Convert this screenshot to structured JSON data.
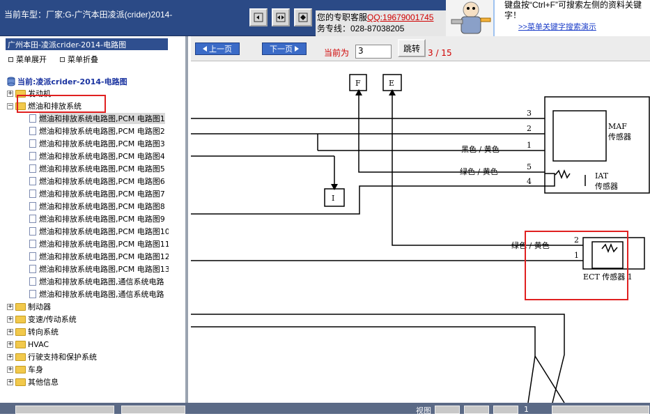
{
  "topbar": {
    "car_model": "当前车型：厂家:G-广汽本田凌派(crider)2014-",
    "support_line1_prefix": "您的专职客服",
    "support_qq": "QQ:19679001745",
    "support_line2": "务专线：028-87038205",
    "tip_line1": "键盘按“Ctrl+F”可搜索左侧的资料关键",
    "tip_line2": "字！",
    "tip_link": ">>菜单关键字搜索演示"
  },
  "left": {
    "title": "广州本田-凌派crider-2014-电路图",
    "expand_label": "菜单展开",
    "collapse_label": "菜单折叠",
    "current_label": "当前:凌派crider-2014-电路图",
    "tree": [
      {
        "label": "发动机",
        "expanded": false
      },
      {
        "label": "燃油和排放系统",
        "expanded": true
      },
      {
        "label": "制动器",
        "expanded": false
      },
      {
        "label": "变速/传动系统",
        "expanded": false
      },
      {
        "label": "转向系统",
        "expanded": false
      },
      {
        "label": "HVAC",
        "expanded": false
      },
      {
        "label": "行驶支持和保护系统",
        "expanded": false
      },
      {
        "label": "车身",
        "expanded": false
      },
      {
        "label": "其他信息",
        "expanded": false
      }
    ],
    "leaves": [
      "燃油和排放系统电路图,PCM 电路图1",
      "燃油和排放系统电路图,PCM 电路图2",
      "燃油和排放系统电路图,PCM 电路图3",
      "燃油和排放系统电路图,PCM 电路图4",
      "燃油和排放系统电路图,PCM 电路图5",
      "燃油和排放系统电路图,PCM 电路图6",
      "燃油和排放系统电路图,PCM 电路图7",
      "燃油和排放系统电路图,PCM 电路图8",
      "燃油和排放系统电路图,PCM 电路图9",
      "燃油和排放系统电路图,PCM 电路图10",
      "燃油和排放系统电路图,PCM 电路图11",
      "燃油和排放系统电路图,PCM 电路图12",
      "燃油和排放系统电路图,PCM 电路图13",
      "燃油和排放系统电路图,通信系统电路",
      "燃油和排放系统电路图,通信系统电路"
    ]
  },
  "nav": {
    "prev_label": "上一页",
    "next_label": "下一页",
    "current_prefix": "当前为",
    "page_value": "3",
    "jump_label": "跳转",
    "page_count": "3 / 15"
  },
  "diagram": {
    "conn_f": "F",
    "conn_e": "E",
    "conn_i": "I",
    "pin3": "3",
    "pin2": "2",
    "pin1": "1",
    "pin5": "5",
    "pin4": "4",
    "ect_pin2": "2",
    "ect_pin1": "1",
    "wire_black_yellow": "黑色 / 黄色",
    "wire_green_yellow_1": "绿色 / 黄色",
    "wire_green_yellow_2": "绿色 / 黄色",
    "maf_line1": "MAF",
    "maf_line2": "传感器",
    "iat_line1": "IAT",
    "iat_line2": "传感器",
    "ect_label": "ECT 传感器 1"
  },
  "bottom": {
    "view_label": "视图",
    "page_num": "1"
  },
  "colors": {
    "topbar": "#2b4a86",
    "highlight": "#e02020",
    "nav_button": "#3b6bc7"
  }
}
